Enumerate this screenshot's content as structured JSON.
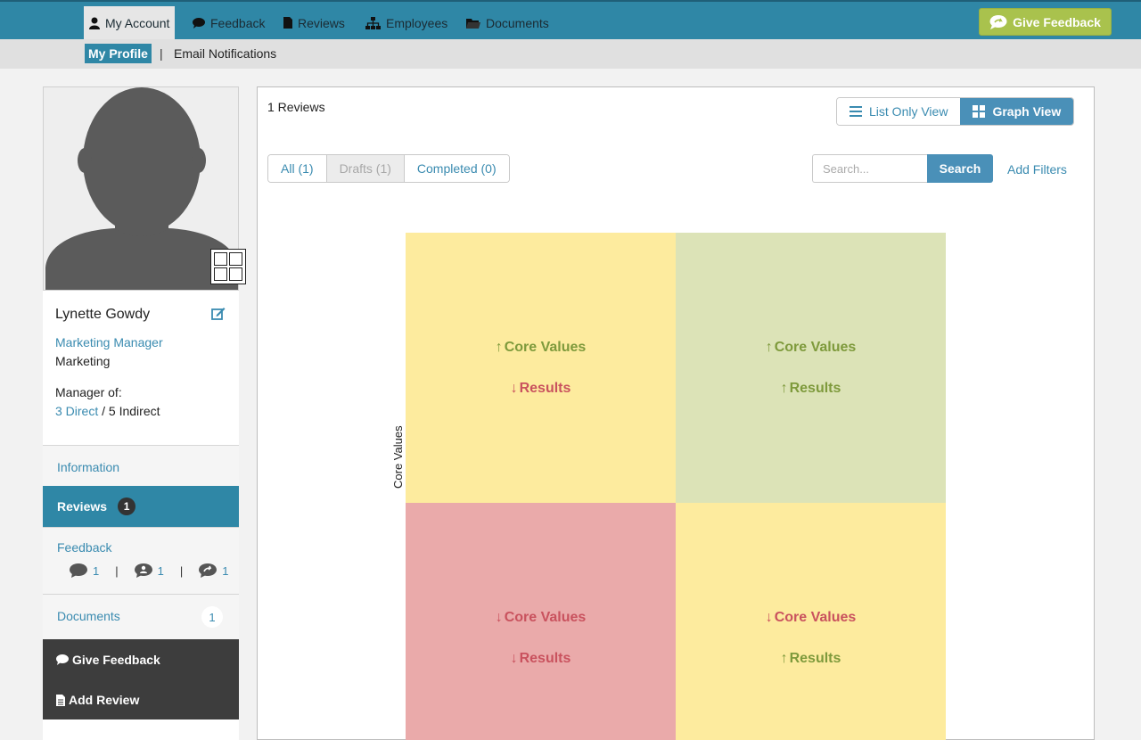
{
  "nav": {
    "items": [
      {
        "label": "My Account",
        "icon": "user-icon"
      },
      {
        "label": "Feedback",
        "icon": "comment-icon"
      },
      {
        "label": "Reviews",
        "icon": "file-icon"
      },
      {
        "label": "Employees",
        "icon": "sitemap-icon"
      },
      {
        "label": "Documents",
        "icon": "folder-icon"
      }
    ],
    "give_feedback": "Give Feedback"
  },
  "subnav": {
    "active": "My Profile",
    "separator": "|",
    "link": "Email Notifications"
  },
  "profile": {
    "name": "Lynette Gowdy",
    "title": "Marketing Manager",
    "department": "Marketing",
    "manager_of_label": "Manager of:",
    "direct": "3 Direct",
    "indirect": " / 5 Indirect"
  },
  "sidebar": {
    "information": "Information",
    "reviews": {
      "label": "Reviews",
      "count": "1"
    },
    "feedback": {
      "label": "Feedback",
      "counts": [
        "1",
        "1",
        "1"
      ]
    },
    "documents": {
      "label": "Documents",
      "count": "1"
    },
    "give_feedback": "Give Feedback",
    "add_review": "Add Review"
  },
  "main": {
    "review_count": "1 Reviews",
    "views": {
      "list": "List Only View",
      "graph": "Graph View",
      "active": "graph"
    },
    "filters": {
      "all": "All (1)",
      "drafts": "Drafts (1)",
      "completed": "Completed (0)"
    },
    "search": {
      "placeholder": "Search...",
      "button": "Search"
    },
    "add_filters": "Add Filters",
    "y_axis_label": "Core Values"
  },
  "quadrants": [
    {
      "core_values": "Core Values",
      "core_dir": "up",
      "results": "Results",
      "results_dir": "down",
      "color": "#fdeb9e"
    },
    {
      "core_values": "Core Values",
      "core_dir": "up",
      "results": "Results",
      "results_dir": "up",
      "color": "#dce3b7"
    },
    {
      "core_values": "Core Values",
      "core_dir": "down",
      "results": "Results",
      "results_dir": "down",
      "color": "#eaaaaa"
    },
    {
      "core_values": "Core Values",
      "core_dir": "down",
      "results": "Results",
      "results_dir": "up",
      "color": "#fdeb9e"
    }
  ],
  "colors": {
    "nav_bg": "#2f87a6",
    "accent": "#4a90b8",
    "link": "#3a8bb0",
    "give_feedback": "#a9c24d",
    "up_arrow": "#7e9a3c",
    "down_arrow": "#c9525e"
  }
}
